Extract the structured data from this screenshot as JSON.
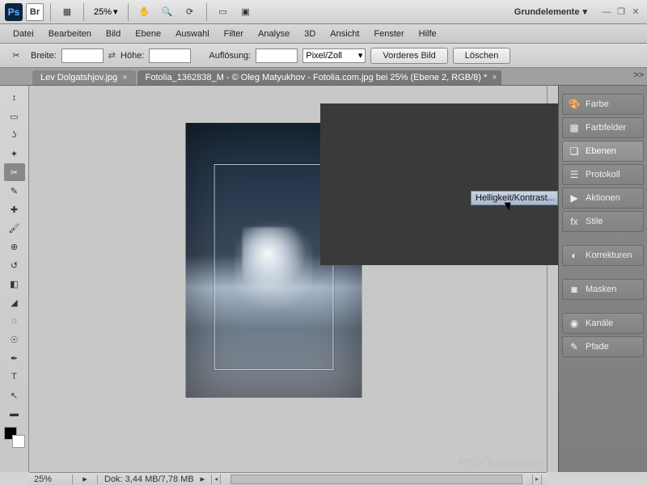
{
  "topbar": {
    "logo_ps": "Ps",
    "logo_br": "Br",
    "zoom": "25%",
    "workspace": "Grundelemente"
  },
  "menubar": {
    "items": [
      "Datei",
      "Bearbeiten",
      "Bild",
      "Ebene",
      "Auswahl",
      "Filter",
      "Analyse",
      "3D",
      "Ansicht",
      "Fenster",
      "Hilfe"
    ]
  },
  "options": {
    "breite_label": "Breite:",
    "hoehe_label": "Höhe:",
    "aufloesung_label": "Auflösung:",
    "unit": "Pixel/Zoll",
    "btn_front": "Vorderes Bild",
    "btn_clear": "Löschen"
  },
  "tabs": {
    "tab1": "Lev Dolgatshjov.jpg",
    "tab2": "Fotolia_1362838_M - © Oleg Matyukhov - Fotolia.com.jpg bei 25% (Ebene 2, RGB/8) *",
    "more": ">>"
  },
  "flyout": {
    "item": "Helligkeit/Kontrast..."
  },
  "panels": {
    "farbe": "Farbe",
    "farbfelder": "Farbfelder",
    "ebenen": "Ebenen",
    "protokoll": "Protokoll",
    "aktionen": "Aktionen",
    "stile": "Stile",
    "korrekturen": "Korrekturen",
    "masken": "Masken",
    "kanaele": "Kanäle",
    "pfade": "Pfade"
  },
  "status": {
    "zoom": "25%",
    "doc": "Dok: 3,44 MB/7,78 MB"
  },
  "watermark": "PSD-Tutorials.de"
}
